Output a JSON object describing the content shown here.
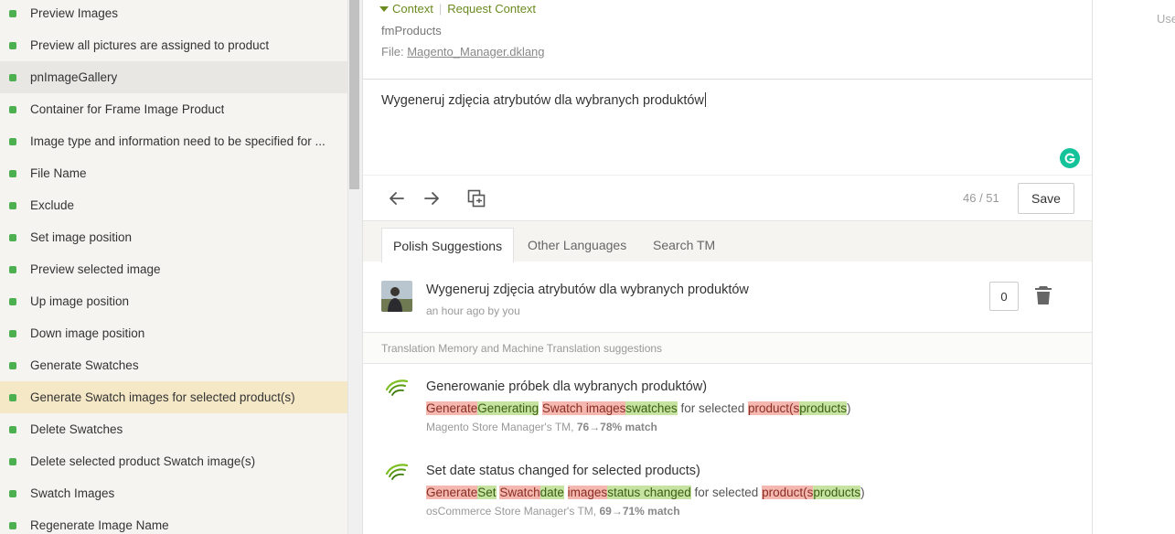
{
  "sidebar": {
    "items": [
      {
        "label": "Preview Images",
        "state": "normal"
      },
      {
        "label": "Preview all pictures are assigned to product",
        "state": "normal"
      },
      {
        "label": "pnImageGallery",
        "state": "hovered"
      },
      {
        "label": "Container for Frame Image Product",
        "state": "normal"
      },
      {
        "label": "Image type and information need to be specified for ...",
        "state": "normal"
      },
      {
        "label": "File Name",
        "state": "normal"
      },
      {
        "label": "Exclude",
        "state": "normal"
      },
      {
        "label": "Set image position",
        "state": "normal"
      },
      {
        "label": "Preview selected image",
        "state": "normal"
      },
      {
        "label": "Up image position",
        "state": "normal"
      },
      {
        "label": "Down image position",
        "state": "normal"
      },
      {
        "label": "Generate Swatches",
        "state": "normal"
      },
      {
        "label": "Generate Swatch images for selected product(s)",
        "state": "active"
      },
      {
        "label": "Delete Swatches",
        "state": "normal"
      },
      {
        "label": "Delete selected product Swatch image(s)",
        "state": "normal"
      },
      {
        "label": "Swatch Images",
        "state": "normal"
      },
      {
        "label": "Regenerate Image Name",
        "state": "normal"
      }
    ],
    "dot_color": "#4caf50"
  },
  "context": {
    "context_label": "Context",
    "request_label": "Request Context",
    "key": "fmProducts",
    "file_prefix": "File:",
    "file_name": "Magento_Manager.dklang"
  },
  "editor": {
    "text": "Wygeneruj zdjęcia atrybutów dla wybranych produktów"
  },
  "toolbar": {
    "counter": "46 / 51",
    "save_label": "Save"
  },
  "tabs": [
    {
      "label": "Polish Suggestions",
      "active": true
    },
    {
      "label": "Other Languages",
      "active": false
    },
    {
      "label": "Search TM",
      "active": false
    }
  ],
  "suggestion": {
    "text": "Wygeneruj zdjęcia atrybutów dla wybranych produktów",
    "meta": "an hour ago by you",
    "votes": "0"
  },
  "tm": {
    "header": "Translation Memory and Machine Translation suggestions",
    "entries": [
      {
        "title": "Generowanie próbek dla wybranych produktów)",
        "diff": [
          {
            "t": "Generate",
            "k": "del"
          },
          {
            "t": "Generating",
            "k": "ins"
          },
          {
            "t": " ",
            "k": "eq"
          },
          {
            "t": "Swatch images",
            "k": "del"
          },
          {
            "t": "swatches",
            "k": "ins"
          },
          {
            "t": " for selected ",
            "k": "eq"
          },
          {
            "t": "product(s",
            "k": "del"
          },
          {
            "t": "products",
            "k": "ins"
          },
          {
            "t": ")",
            "k": "eq"
          }
        ],
        "source": "Magento Store Manager's TM,",
        "match": "76→78% match"
      },
      {
        "title": "Set date status changed for selected products)",
        "diff": [
          {
            "t": "Generate",
            "k": "del"
          },
          {
            "t": "Set",
            "k": "ins"
          },
          {
            "t": " ",
            "k": "eq"
          },
          {
            "t": "Swatch",
            "k": "del"
          },
          {
            "t": "date",
            "k": "ins"
          },
          {
            "t": " ",
            "k": "eq"
          },
          {
            "t": "images",
            "k": "del"
          },
          {
            "t": "status changed",
            "k": "ins"
          },
          {
            "t": " for selected ",
            "k": "eq"
          },
          {
            "t": "product(s",
            "k": "del"
          },
          {
            "t": "products",
            "k": "ins"
          },
          {
            "t": ")",
            "k": "eq"
          }
        ],
        "source": "osCommerce Store Manager's TM,",
        "match": "69→71% match"
      }
    ]
  },
  "user_area": {
    "label": "Use"
  }
}
